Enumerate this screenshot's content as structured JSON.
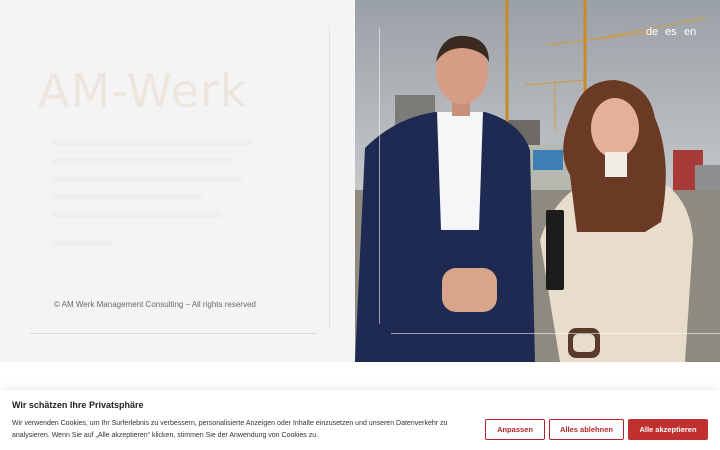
{
  "brand_ghost": "AM-Werk",
  "footer": {
    "copyright": "© AM Werk Management Consulting – All rights reserved"
  },
  "languages": [
    "de",
    "es",
    "en"
  ],
  "cookie": {
    "title": "Wir schätzen Ihre Privatsphäre",
    "text": "Wir verwenden Cookies, um Ihr Surferlebnis zu verbessern, personalisierte Anzeigen oder Inhalte einzusetzen und unseren Datenverkehr zu analysieren. Wenn Sie auf „Alle akzeptieren“ klicken, stimmen Sie der Anwendung von Cookies zu.",
    "customize_label": "Anpassen",
    "reject_label": "Alles ablehnen",
    "accept_label": "Alle akzeptieren"
  },
  "colors": {
    "accent": "#c0302e",
    "panel_bg": "#f4f4f4"
  }
}
